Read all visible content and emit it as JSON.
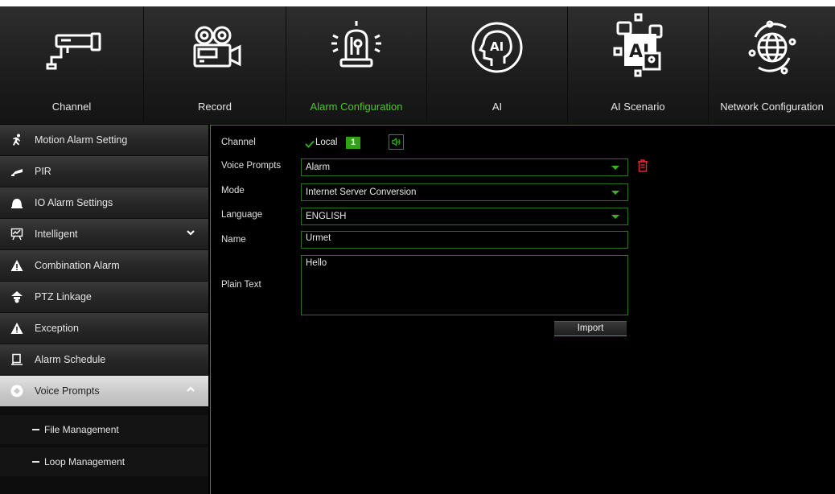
{
  "top_nav": {
    "items": [
      {
        "label": "Channel",
        "icon": "cctv-camera-icon",
        "active": false
      },
      {
        "label": "Record",
        "icon": "video-camera-icon",
        "active": false
      },
      {
        "label": "Alarm Configuration",
        "icon": "siren-icon",
        "active": true
      },
      {
        "label": "AI",
        "icon": "ai-head-icon",
        "active": false
      },
      {
        "label": "AI Scenario",
        "icon": "ai-scenario-icon",
        "active": false
      },
      {
        "label": "Network Configuration",
        "icon": "globe-icon",
        "active": false
      }
    ]
  },
  "sidebar": {
    "items": [
      {
        "label": "Motion Alarm Setting",
        "icon": "running-man-icon"
      },
      {
        "label": "PIR",
        "icon": "pir-sensor-icon"
      },
      {
        "label": "IO Alarm Settings",
        "icon": "bell-icon"
      },
      {
        "label": "Intelligent",
        "icon": "intelligent-icon",
        "chevron": "down"
      },
      {
        "label": "Combination Alarm",
        "icon": "warning-icon"
      },
      {
        "label": "PTZ Linkage",
        "icon": "ptz-camera-icon"
      },
      {
        "label": "Exception",
        "icon": "warning-icon"
      },
      {
        "label": "Alarm Schedule",
        "icon": "schedule-icon"
      },
      {
        "label": "Voice Prompts",
        "icon": "voice-prompts-icon",
        "chevron": "up",
        "expanded": true
      }
    ],
    "sub_items": [
      {
        "label": "File Management"
      },
      {
        "label": "Loop Management"
      }
    ]
  },
  "form": {
    "channel_label": "Channel",
    "local_label": "Local",
    "channel_number": "1",
    "voice_prompts_label": "Voice Prompts",
    "voice_prompts_value": "Alarm",
    "mode_label": "Mode",
    "mode_value": "Internet Server Conversion",
    "language_label": "Language",
    "language_value": "ENGLISH",
    "name_label": "Name",
    "name_value": "Urmet",
    "plain_text_label": "Plain Text",
    "plain_text_value": "Hello",
    "import_label": "Import"
  },
  "colors": {
    "accent_green": "#39b51c",
    "active_label": "#4cc82a",
    "delete_red": "#e0282a",
    "background": "#000000"
  }
}
